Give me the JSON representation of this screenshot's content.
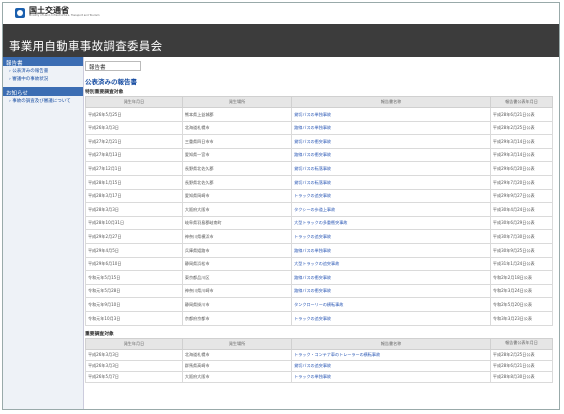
{
  "header": {
    "org_name": "国土交通省",
    "org_name_en": "Ministry of Land, Infrastructure, Transport and Tourism",
    "site_title": "事業用自動車事故調査委員会"
  },
  "sidebar": {
    "sections": [
      {
        "heading": "報告書",
        "items": [
          "公表済みの報告書",
          "審議中の事故状況"
        ]
      },
      {
        "heading": "お知らせ",
        "items": [
          "事故の調査及び審議について"
        ]
      }
    ]
  },
  "main": {
    "tab_label": "報告書",
    "section_title": "公表済みの報告書",
    "groups": [
      {
        "title": "特別重要調査対象",
        "columns": [
          "発生年月日",
          "発生場所",
          "報告書名称",
          "報告書公表年月日"
        ],
        "rows": [
          [
            "平成26年5月25日",
            "熊本県上益城郡",
            "貸切バスの単独事故",
            "平成28年6月21日公表"
          ],
          [
            "平成26年3月3日",
            "北海道札幌市",
            "路線バスの単独事故",
            "平成28年2月25日公表"
          ],
          [
            "平成27年2月21日",
            "三重県四日市市",
            "貸切バスの衝突事故",
            "平成29年3月14日公表"
          ],
          [
            "平成27年8月13日",
            "愛知県一宮市",
            "路線バスの衝突事故",
            "平成29年3月14日公表"
          ],
          [
            "平成27年12月1日",
            "長野県北佐久郡",
            "貸切バスの転落事故",
            "平成29年6月20日公表"
          ],
          [
            "平成28年1月15日",
            "長野県北佐久郡",
            "貸切バスの転落事故",
            "平成29年7月20日公表"
          ],
          [
            "平成28年3月17日",
            "愛知県岡崎市",
            "トラックの追突事故",
            "平成29年9月27日公表"
          ],
          [
            "平成28年3月3日",
            "大阪府大阪市",
            "タクシーの歩道上事故",
            "平成30年4月24日公表"
          ],
          [
            "平成28年10月31日",
            "岐阜県羽島郡岐南町",
            "大型トラックの多重衝突事故",
            "平成30年6月29日公表"
          ],
          [
            "平成29年2月27日",
            "神奈川県横浜市",
            "トラックの追突事故",
            "平成30年7月30日公表"
          ],
          [
            "平成29年4月5日",
            "兵庫県姫路市",
            "路線バスの単独事故",
            "平成30年9月25日公表"
          ],
          [
            "平成29年6月10日",
            "静岡県浜松市",
            "大型トラックの追突事故",
            "平成31年1月24日公表"
          ],
          [
            "令和元年5月15日",
            "東京都品川区",
            "路線バスの衝突事故",
            "令和2年2月18日公表"
          ],
          [
            "令和元年5月28日",
            "神奈川県川崎市",
            "路線バスの衝突事故",
            "令和2年3月24日公表"
          ],
          [
            "令和元年9月10日",
            "静岡県掛川市",
            "タンクローリーの横転事故",
            "令和2年5月20日公表"
          ],
          [
            "令和元年10月3日",
            "京都府京都市",
            "トラックの追突事故",
            "令和3年3月23日公表"
          ]
        ]
      },
      {
        "title": "重要調査対象",
        "columns": [
          "発生年月日",
          "発生場所",
          "報告書名称",
          "報告書公表年月日"
        ],
        "rows": [
          [
            "平成26年3月3日",
            "北海道札幌市",
            "トラック・コンテナ車のトレーラーの横転事故",
            "平成28年2月25日公表"
          ],
          [
            "平成26年3月3日",
            "群馬県高崎市",
            "貸切バスの追突事故",
            "平成28年6月21日公表"
          ],
          [
            "平成26年5月7日",
            "大阪府大阪市",
            "トラックの単独事故",
            "平成28年8月30日公表"
          ]
        ]
      }
    ]
  }
}
